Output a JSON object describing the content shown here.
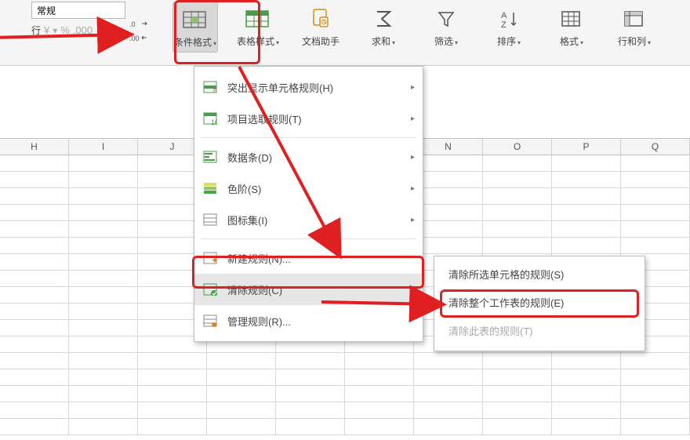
{
  "ribbon": {
    "number_format_value": "常规",
    "row_label": "行",
    "currency_glyph": "¥",
    "percent_glyph": "%",
    "thousands_glyph": ".000",
    "dec_inc": ".00→.0",
    "dec_dec": ".0→.00",
    "tools": {
      "cond_fmt": "条件格式",
      "table_style": "表格样式",
      "doc_helper": "文档助手",
      "sum": "求和",
      "filter": "筛选",
      "sort": "排序",
      "format": "格式",
      "rowcol": "行和列"
    }
  },
  "columns": [
    "H",
    "I",
    "J",
    "",
    "",
    "",
    "N",
    "O",
    "P",
    "Q"
  ],
  "menu": {
    "highlight": "突出显示单元格规则(H)",
    "toprules": "项目选取规则(T)",
    "databars": "数据条(D)",
    "colorscale": "色阶(S)",
    "iconset": "图标集(I)",
    "newrule": "新建规则(N)...",
    "clear": "清除规则(C)",
    "manage": "管理规则(R)..."
  },
  "submenu": {
    "clear_selection": "清除所选单元格的规则(S)",
    "clear_sheet": "清除整个工作表的规则(E)",
    "clear_table": "清除此表的规则(T)"
  }
}
